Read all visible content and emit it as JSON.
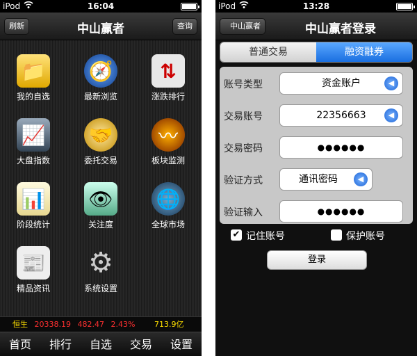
{
  "left": {
    "status": {
      "carrier": "iPod",
      "time": "16:04"
    },
    "nav": {
      "title": "中山赢者",
      "left_btn": "刷新",
      "right_btn": "查询"
    },
    "grid": [
      {
        "label": "我的自选",
        "icon": "folder-icon",
        "glyph": "📁"
      },
      {
        "label": "最新浏览",
        "icon": "compass-icon",
        "glyph": "🧭"
      },
      {
        "label": "涨跌排行",
        "icon": "updown-arrows-icon",
        "glyph": "⇅"
      },
      {
        "label": "大盘指数",
        "icon": "monitor-chart-icon",
        "glyph": "📈"
      },
      {
        "label": "委托交易",
        "icon": "handshake-icon",
        "glyph": "🤝"
      },
      {
        "label": "板块监测",
        "icon": "wave-monitor-icon",
        "glyph": "〰"
      },
      {
        "label": "阶段统计",
        "icon": "notepad-chart-icon",
        "glyph": "📊"
      },
      {
        "label": "关注度",
        "icon": "eye-icon",
        "glyph": "👁"
      },
      {
        "label": "全球市场",
        "icon": "globe-icon",
        "glyph": "🌐"
      },
      {
        "label": "精品资讯",
        "icon": "newspaper-icon",
        "glyph": "📰"
      },
      {
        "label": "系统设置",
        "icon": "gear-icon",
        "glyph": "⚙"
      }
    ],
    "ticker": {
      "name": "恒生",
      "value": "20338.19",
      "change": "482.47",
      "pct": "2.43%",
      "volume": "713.9亿"
    },
    "tabs": [
      "首页",
      "排行",
      "自选",
      "交易",
      "设置"
    ]
  },
  "right": {
    "status": {
      "carrier": "iPod",
      "time": "13:28"
    },
    "nav": {
      "title": "中山赢者登录",
      "back_btn": "中山赢者"
    },
    "segments": [
      "普通交易",
      "融资融券"
    ],
    "form": {
      "account_type": {
        "label": "账号类型",
        "value": "资金账户"
      },
      "account_no": {
        "label": "交易账号",
        "value": "22356663"
      },
      "password": {
        "label": "交易密码",
        "value": "●●●●●●"
      },
      "verify_method": {
        "label": "验证方式",
        "value": "通讯密码"
      },
      "verify_input": {
        "label": "验证输入",
        "value": "●●●●●●"
      }
    },
    "checks": {
      "remember": "记住账号",
      "protect": "保护账号"
    },
    "login": "登录"
  }
}
